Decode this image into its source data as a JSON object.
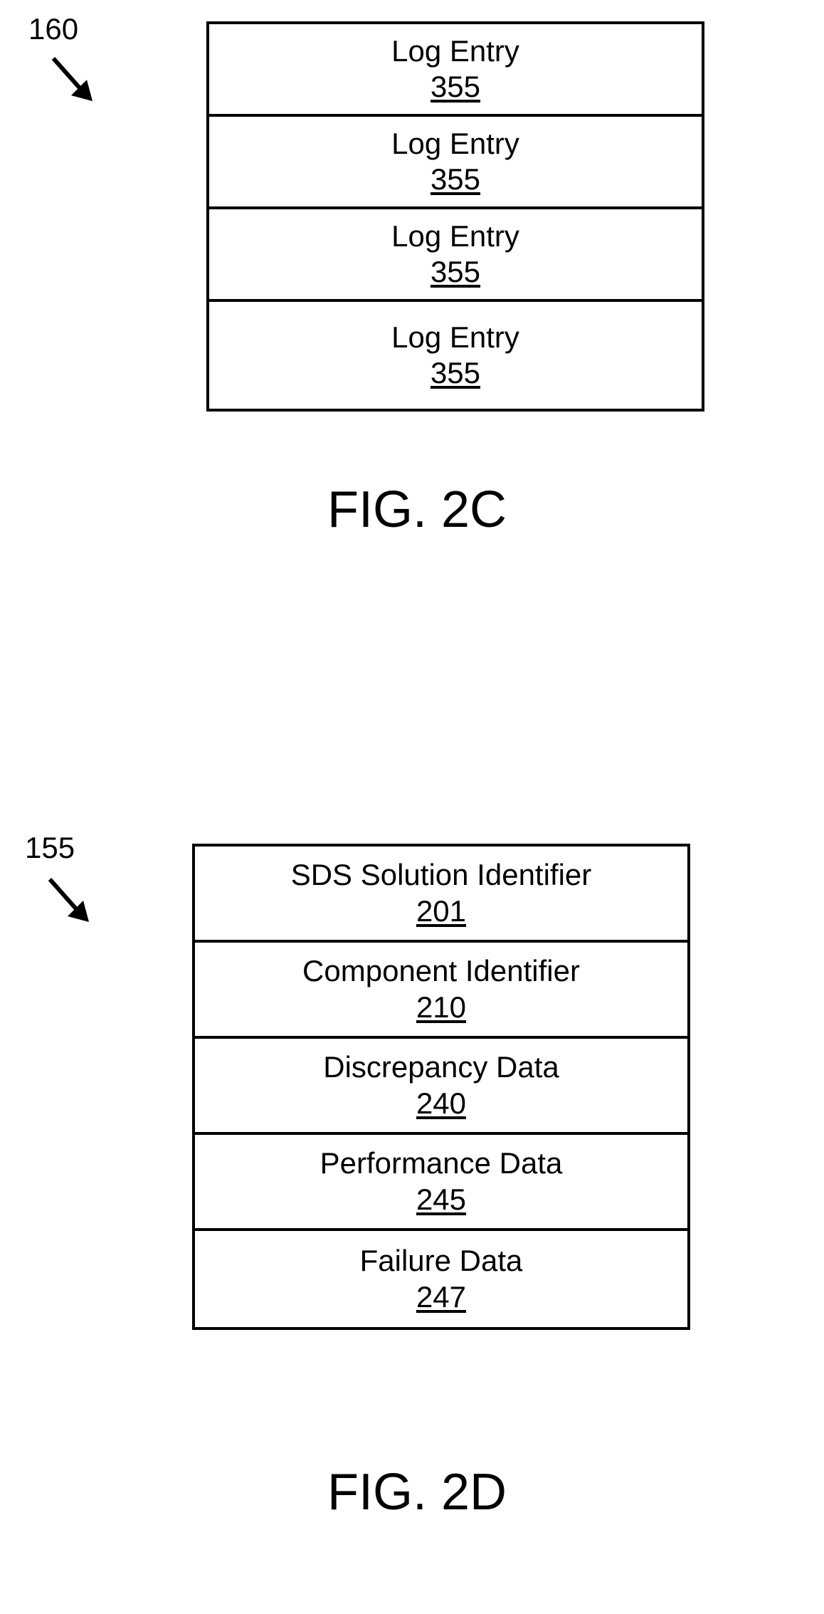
{
  "figure2c": {
    "ref_label": "160",
    "caption": "FIG. 2C",
    "cells": [
      {
        "title": "Log Entry",
        "num": "355"
      },
      {
        "title": "Log Entry",
        "num": "355"
      },
      {
        "title": "Log Entry",
        "num": "355"
      },
      {
        "title": "Log Entry",
        "num": "355"
      }
    ]
  },
  "figure2d": {
    "ref_label": "155",
    "caption": "FIG. 2D",
    "cells": [
      {
        "title": "SDS Solution Identifier",
        "num": "201"
      },
      {
        "title": "Component Identifier",
        "num": "210"
      },
      {
        "title": "Discrepancy Data",
        "num": "240"
      },
      {
        "title": "Performance Data",
        "num": "245"
      },
      {
        "title": "Failure Data",
        "num": "247"
      }
    ]
  }
}
